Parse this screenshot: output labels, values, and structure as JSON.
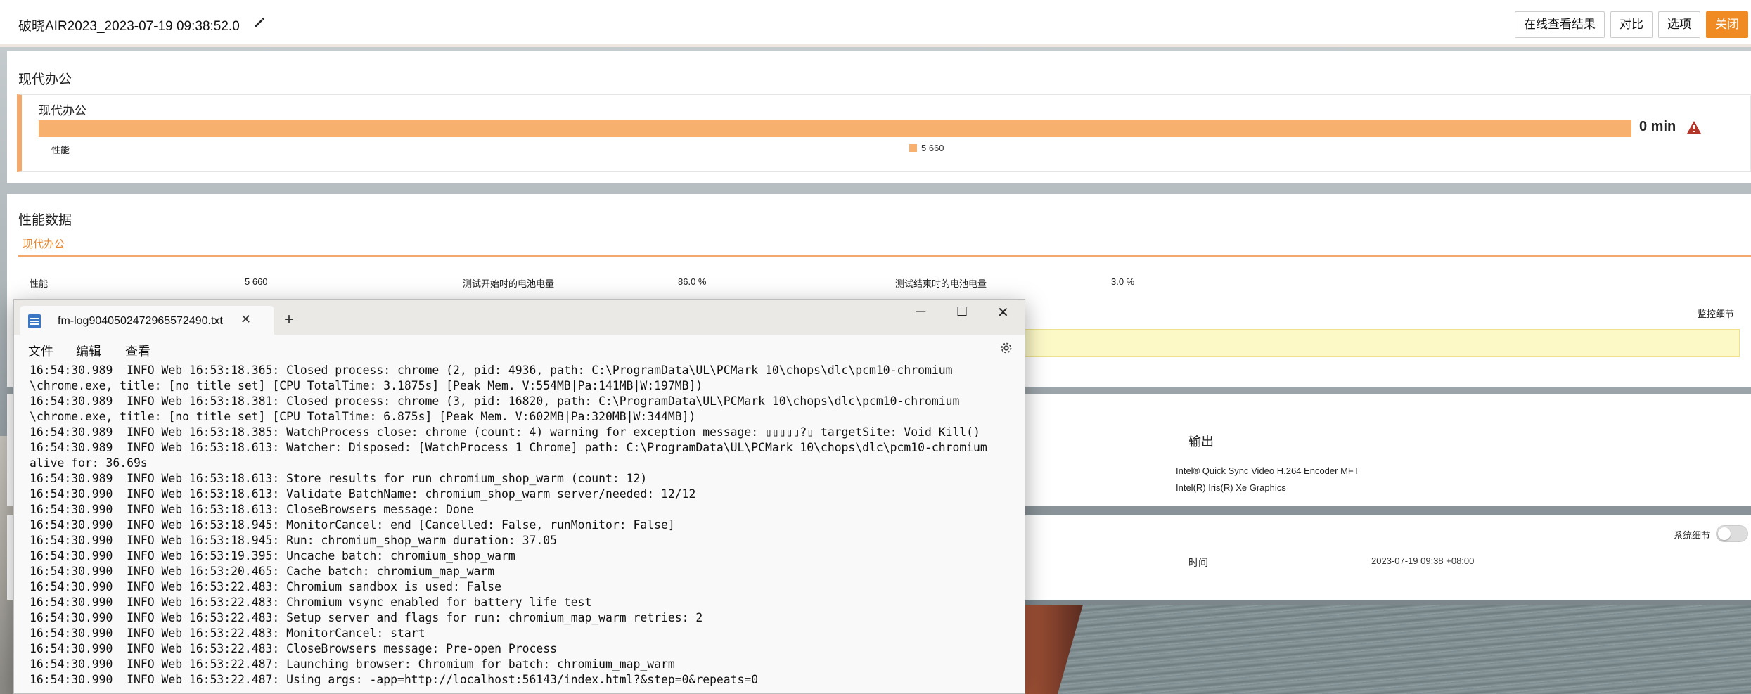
{
  "header": {
    "title": "破晓AIR2023_2023-07-19 09:38:52.0",
    "buttons": {
      "online": "在线查看结果",
      "compare": "对比",
      "options": "选项",
      "close": "关闭"
    }
  },
  "scenario": {
    "heading": "现代办公",
    "card_title": "现代办公",
    "bar_value": "0 min",
    "row_label": "性能",
    "legend_value": "5 660"
  },
  "perf": {
    "heading": "性能数据",
    "tab": "现代办公",
    "items": [
      {
        "label": "性能",
        "value": "5 660"
      },
      {
        "label": "测试开始时的电池电量",
        "value": "86.0 %"
      },
      {
        "label": "测试结束时的电池电量",
        "value": "3.0 %"
      }
    ],
    "monitor_link": "监控细节"
  },
  "output": {
    "heading": "输出",
    "items": [
      "Intel® Quick Sync Video H.264 Encoder MFT",
      "Intel(R) Iris(R) Xe Graphics"
    ]
  },
  "system": {
    "toggle_label": "系统细节",
    "time_label": "时间",
    "time_value": "2023-07-19 09:38 +08:00"
  },
  "notepad": {
    "tab_name": "fm-log9040502472965572490.txt",
    "menus": [
      "文件",
      "编辑",
      "查看"
    ],
    "lines": [
      "16:54:30.989  INFO Web 16:53:18.365: Closed process: chrome (2, pid: 4936, path: C:\\ProgramData\\UL\\PCMark 10\\chops\\dlc\\pcm10-chromium",
      "\\chrome.exe, title: [no title set] [CPU TotalTime: 3.1875s] [Peak Mem. V:554MB|Pa:141MB|W:197MB])",
      "16:54:30.989  INFO Web 16:53:18.381: Closed process: chrome (3, pid: 16820, path: C:\\ProgramData\\UL\\PCMark 10\\chops\\dlc\\pcm10-chromium",
      "\\chrome.exe, title: [no title set] [CPU TotalTime: 6.875s] [Peak Mem. V:602MB|Pa:320MB|W:344MB])",
      "16:54:30.989  INFO Web 16:53:18.385: WatchProcess close: chrome (count: 4) warning for exception message: ▯▯▯▯▯?▯ targetSite: Void Kill()",
      "16:54:30.989  INFO Web 16:53:18.613: Watcher: Disposed: [WatchProcess 1 Chrome] path: C:\\ProgramData\\UL\\PCMark 10\\chops\\dlc\\pcm10-chromium",
      "alive for: 36.69s",
      "16:54:30.989  INFO Web 16:53:18.613: Store results for run chromium_shop_warm (count: 12)",
      "16:54:30.990  INFO Web 16:53:18.613: Validate BatchName: chromium_shop_warm server/needed: 12/12",
      "16:54:30.990  INFO Web 16:53:18.613: CloseBrowsers message: Done",
      "16:54:30.990  INFO Web 16:53:18.945: MonitorCancel: end [Cancelled: False, runMonitor: False]",
      "16:54:30.990  INFO Web 16:53:18.945: Run: chromium_shop_warm duration: 37.05",
      "16:54:30.990  INFO Web 16:53:19.395: Uncache batch: chromium_shop_warm",
      "16:54:30.990  INFO Web 16:53:20.465: Cache batch: chromium_map_warm",
      "16:54:30.990  INFO Web 16:53:22.483: Chromium sandbox is used: False",
      "16:54:30.990  INFO Web 16:53:22.483: Chromium vsync enabled for battery life test",
      "16:54:30.990  INFO Web 16:53:22.483: Setup server and flags for run: chromium_map_warm retries: 2",
      "16:54:30.990  INFO Web 16:53:22.483: MonitorCancel: start",
      "16:54:30.990  INFO Web 16:53:22.483: CloseBrowsers message: Pre-open Process",
      "16:54:30.990  INFO Web 16:53:22.487: Launching browser: Chromium for batch: chromium_map_warm",
      "16:54:30.990  INFO Web 16:53:22.487: Using args: -app=http://localhost:56143/index.html?&step=0&repeats=0"
    ]
  },
  "colors": {
    "accent": "#f08a22",
    "bar": "#f8b06e",
    "warn": "#b3362b"
  }
}
